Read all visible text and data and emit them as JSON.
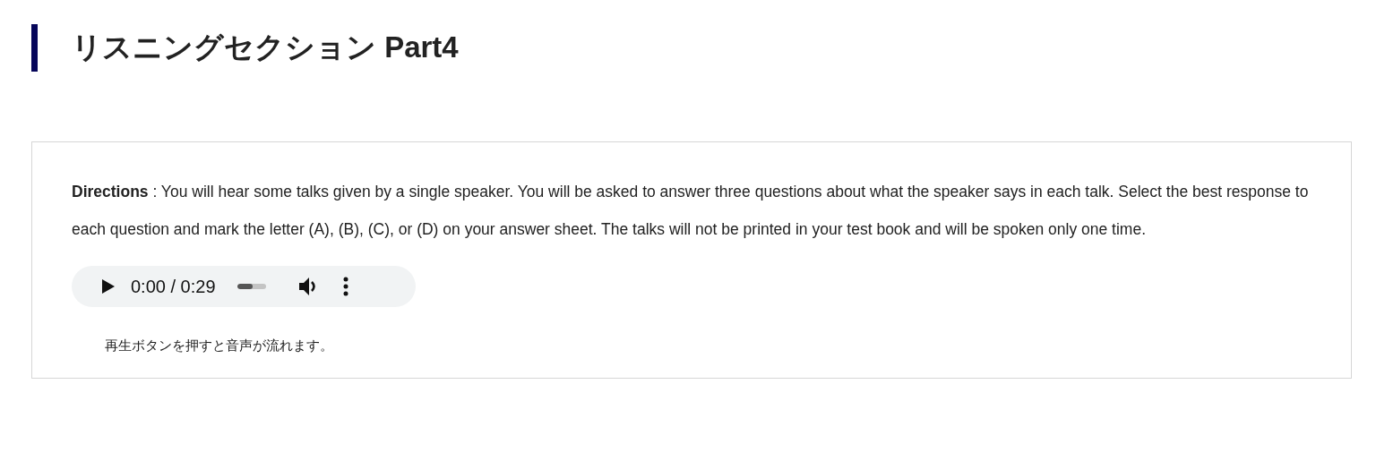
{
  "heading": "リスニングセクション Part4",
  "directions": "**Directions** : You will hear some talks given by a single speaker. You will be asked to answer three questions about what the speaker says in each talk. Select the best response to each question and mark the letter (A), (B), (C), or (D) on your answer sheet. The talks will not be printed in your test book and will be spoken only one time.",
  "audio_player": {
    "time": "0:00 / 0:29",
    "level": 0.55
  },
  "caption": "再生ボタンを押すと音声が流れます。"
}
